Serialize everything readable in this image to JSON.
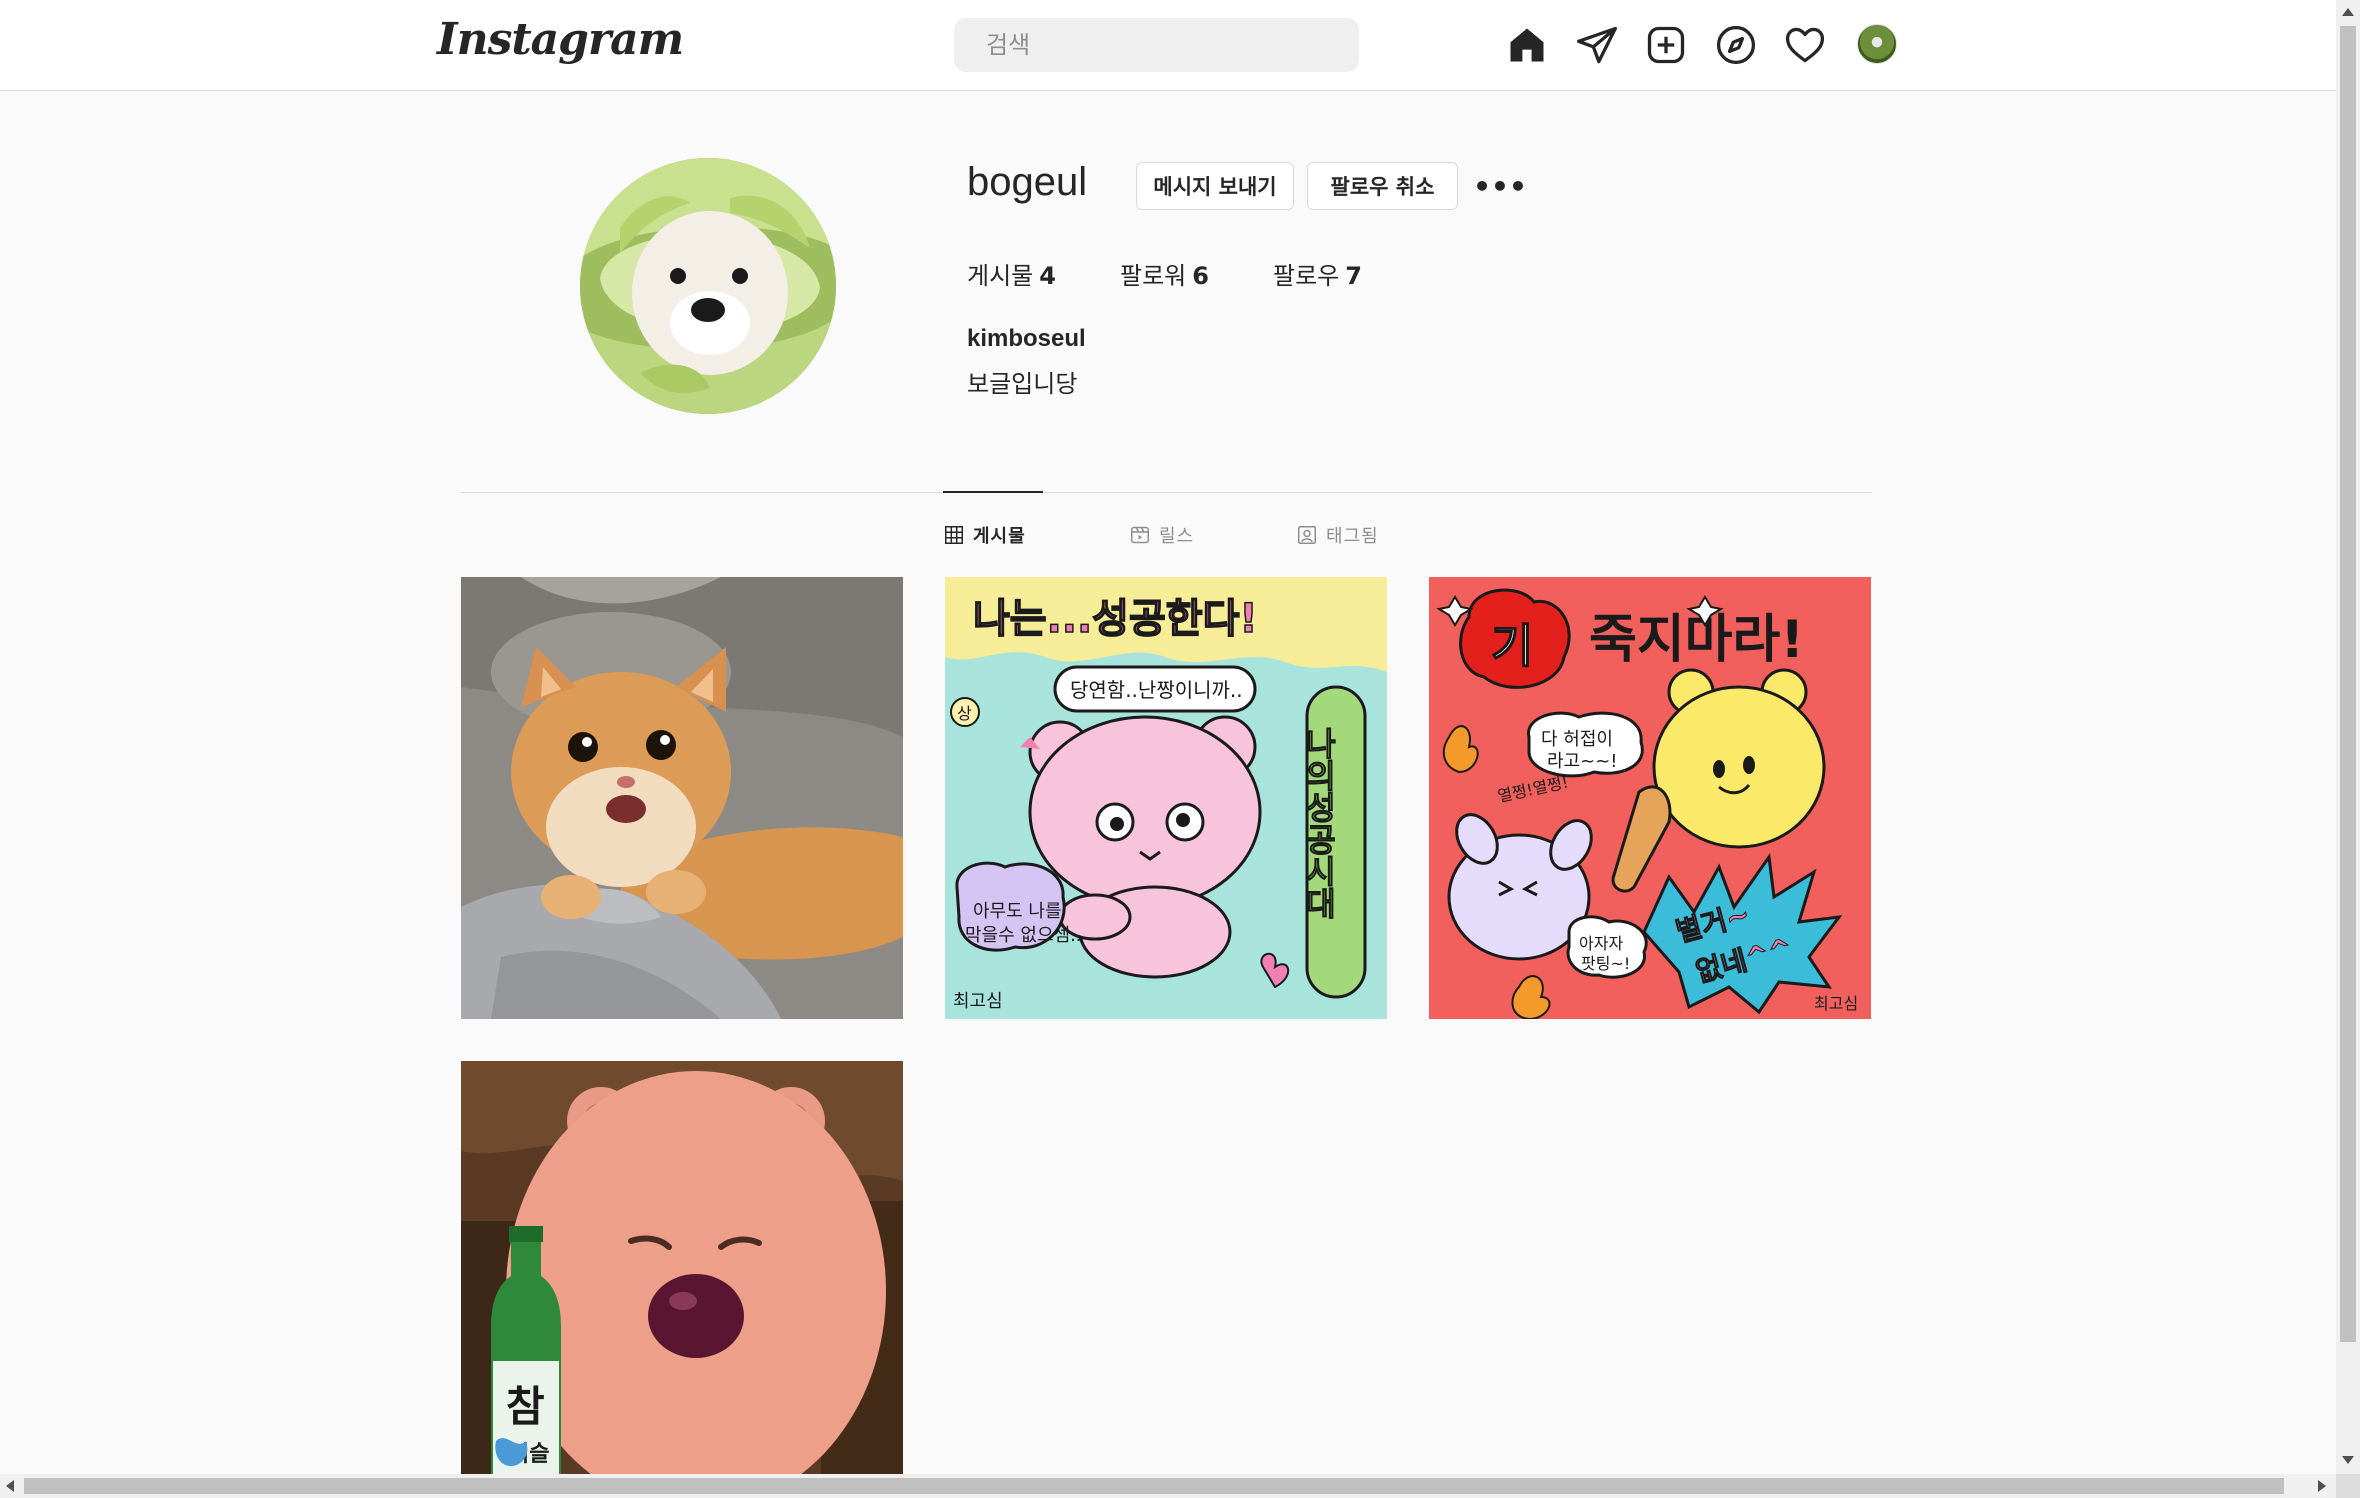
{
  "nav": {
    "logo_text": "Instagram",
    "search_placeholder": "검색",
    "icons": [
      "home-icon",
      "direct-message-icon",
      "new-post-icon",
      "explore-icon",
      "activity-heart-icon",
      "profile-avatar"
    ]
  },
  "profile": {
    "username": "bogeul",
    "message_button": "메시지 보내기",
    "unfollow_button": "팔로우 취소",
    "more_button": "•••",
    "stats": [
      {
        "label": "게시물",
        "count": "4"
      },
      {
        "label": "팔로워",
        "count": "6"
      },
      {
        "label": "팔로우",
        "count": "7"
      }
    ],
    "full_name": "kimboseul",
    "bio": "보글입니당"
  },
  "tabs": [
    {
      "label": "게시물",
      "icon": "grid-icon",
      "active": true
    },
    {
      "label": "릴스",
      "icon": "reels-icon",
      "active": false
    },
    {
      "label": "태그됨",
      "icon": "tagged-icon",
      "active": false
    }
  ],
  "posts": {
    "post2": {
      "headline": "나는...성공한다!",
      "bubble_top": "당연함..난짱이니까..",
      "side_text": "나의성공시대",
      "bubble_bottom_1": "아무도 나를",
      "bubble_bottom_2": "막을수 없으셈..",
      "sign": "최고심",
      "badge": "상"
    },
    "post3": {
      "headline_ki": "기",
      "headline_rest": "죽지마라!",
      "bubble_1": "다 허접이",
      "bubble_2": "라고~~!",
      "side_text": "열쩡!열쩡!",
      "burst_1": "별거~",
      "burst_2": "없네^^",
      "cheer_1": "아자자",
      "cheer_2": "팟팅~!",
      "sign": "최고심"
    },
    "post4": {
      "bottle_text": "참",
      "bottle_sub": "이슬"
    }
  },
  "colors": {
    "accent": "#262626",
    "border": "#dbdbdb",
    "muted": "#8e8e8e",
    "background": "#fafafa"
  }
}
